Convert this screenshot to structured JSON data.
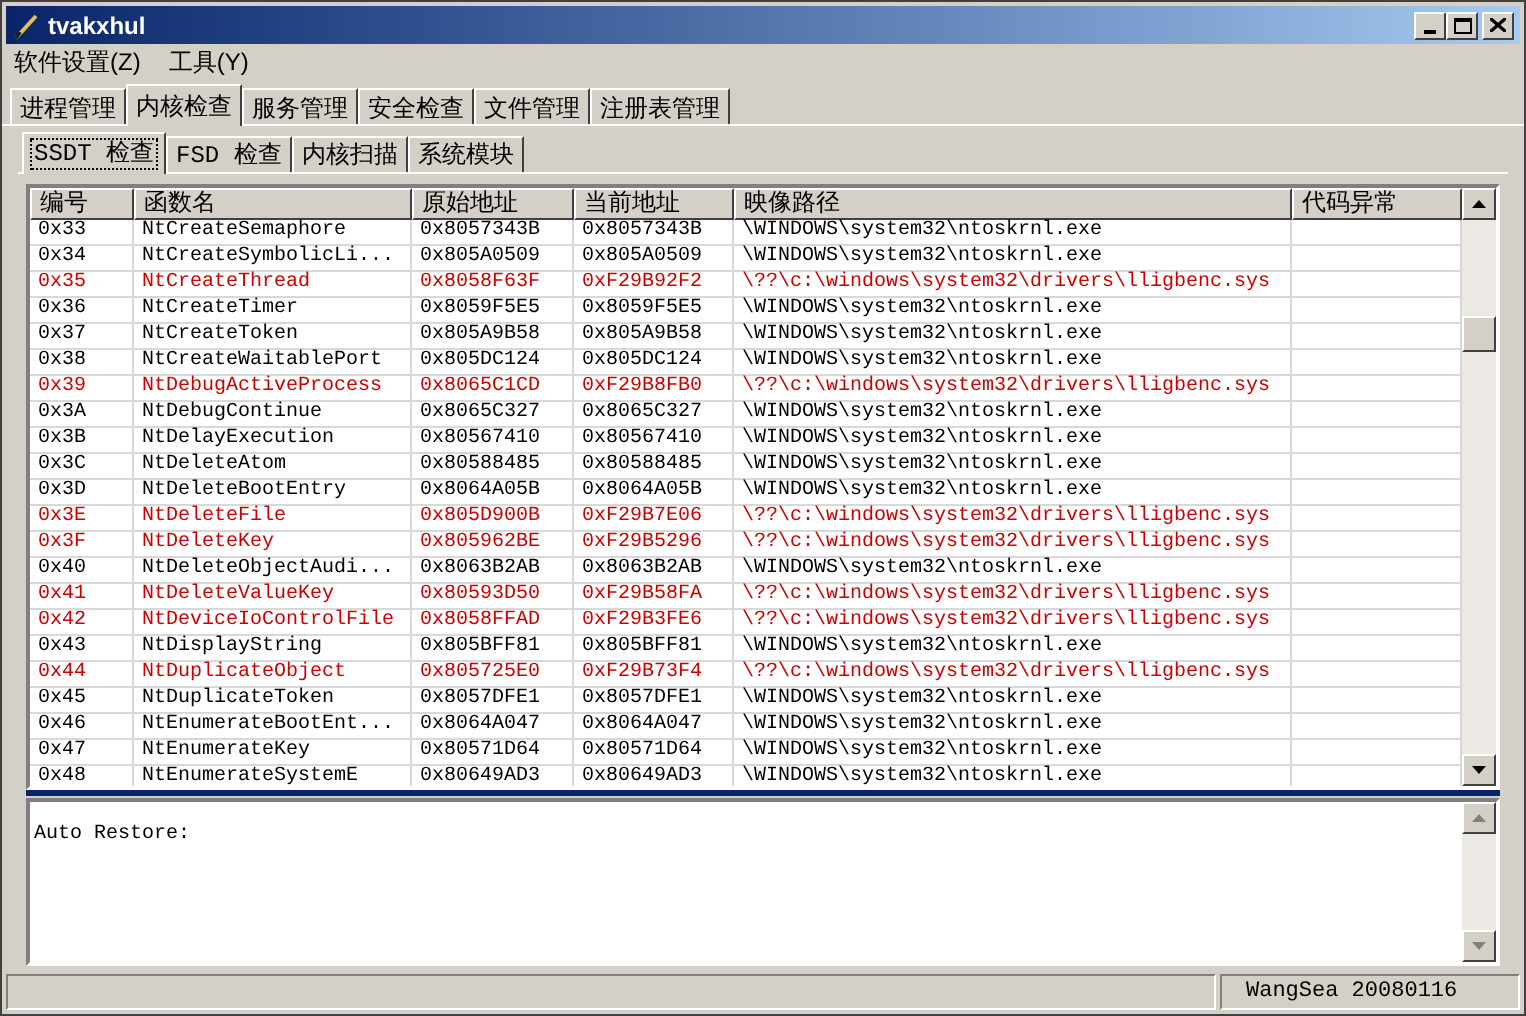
{
  "window": {
    "title": "tvakxhul"
  },
  "menu": [
    "软件设置(Z)",
    "工具(Y)"
  ],
  "tabs": [
    {
      "label": "进程管理",
      "selected": false
    },
    {
      "label": "内核检查",
      "selected": true
    },
    {
      "label": "服务管理",
      "selected": false
    },
    {
      "label": "安全检查",
      "selected": false
    },
    {
      "label": "文件管理",
      "selected": false
    },
    {
      "label": "注册表管理",
      "selected": false
    }
  ],
  "subtabs": [
    {
      "label": "SSDT 检查",
      "selected": true
    },
    {
      "label": "FSD 检查",
      "selected": false
    },
    {
      "label": "内核扫描",
      "selected": false
    },
    {
      "label": "系统模块",
      "selected": false
    }
  ],
  "table": {
    "columns": [
      "编号",
      "函数名",
      "原始地址",
      "当前地址",
      "映像路径",
      "代码异常"
    ],
    "rows": [
      {
        "cells": [
          "0x33",
          "NtCreateSemaphore",
          "0x8057343B",
          "0x8057343B",
          "\\WINDOWS\\system32\\ntoskrnl.exe"
        ],
        "hooked": false
      },
      {
        "cells": [
          "0x34",
          "NtCreateSymbolicLi...",
          "0x805A0509",
          "0x805A0509",
          "\\WINDOWS\\system32\\ntoskrnl.exe"
        ],
        "hooked": false
      },
      {
        "cells": [
          "0x35",
          "NtCreateThread",
          "0x8058F63F",
          "0xF29B92F2",
          "\\??\\c:\\windows\\system32\\drivers\\lligbenc.sys"
        ],
        "hooked": true
      },
      {
        "cells": [
          "0x36",
          "NtCreateTimer",
          "0x8059F5E5",
          "0x8059F5E5",
          "\\WINDOWS\\system32\\ntoskrnl.exe"
        ],
        "hooked": false
      },
      {
        "cells": [
          "0x37",
          "NtCreateToken",
          "0x805A9B58",
          "0x805A9B58",
          "\\WINDOWS\\system32\\ntoskrnl.exe"
        ],
        "hooked": false
      },
      {
        "cells": [
          "0x38",
          "NtCreateWaitablePort",
          "0x805DC124",
          "0x805DC124",
          "\\WINDOWS\\system32\\ntoskrnl.exe"
        ],
        "hooked": false
      },
      {
        "cells": [
          "0x39",
          "NtDebugActiveProcess",
          "0x8065C1CD",
          "0xF29B8FB0",
          "\\??\\c:\\windows\\system32\\drivers\\lligbenc.sys"
        ],
        "hooked": true
      },
      {
        "cells": [
          "0x3A",
          "NtDebugContinue",
          "0x8065C327",
          "0x8065C327",
          "\\WINDOWS\\system32\\ntoskrnl.exe"
        ],
        "hooked": false
      },
      {
        "cells": [
          "0x3B",
          "NtDelayExecution",
          "0x80567410",
          "0x80567410",
          "\\WINDOWS\\system32\\ntoskrnl.exe"
        ],
        "hooked": false
      },
      {
        "cells": [
          "0x3C",
          "NtDeleteAtom",
          "0x80588485",
          "0x80588485",
          "\\WINDOWS\\system32\\ntoskrnl.exe"
        ],
        "hooked": false
      },
      {
        "cells": [
          "0x3D",
          "NtDeleteBootEntry",
          "0x8064A05B",
          "0x8064A05B",
          "\\WINDOWS\\system32\\ntoskrnl.exe"
        ],
        "hooked": false
      },
      {
        "cells": [
          "0x3E",
          "NtDeleteFile",
          "0x805D900B",
          "0xF29B7E06",
          "\\??\\c:\\windows\\system32\\drivers\\lligbenc.sys"
        ],
        "hooked": true
      },
      {
        "cells": [
          "0x3F",
          "NtDeleteKey",
          "0x805962BE",
          "0xF29B5296",
          "\\??\\c:\\windows\\system32\\drivers\\lligbenc.sys"
        ],
        "hooked": true
      },
      {
        "cells": [
          "0x40",
          "NtDeleteObjectAudi...",
          "0x8063B2AB",
          "0x8063B2AB",
          "\\WINDOWS\\system32\\ntoskrnl.exe"
        ],
        "hooked": false
      },
      {
        "cells": [
          "0x41",
          "NtDeleteValueKey",
          "0x80593D50",
          "0xF29B58FA",
          "\\??\\c:\\windows\\system32\\drivers\\lligbenc.sys"
        ],
        "hooked": true
      },
      {
        "cells": [
          "0x42",
          "NtDeviceIoControlFile",
          "0x8058FFAD",
          "0xF29B3FE6",
          "\\??\\c:\\windows\\system32\\drivers\\lligbenc.sys"
        ],
        "hooked": true
      },
      {
        "cells": [
          "0x43",
          "NtDisplayString",
          "0x805BFF81",
          "0x805BFF81",
          "\\WINDOWS\\system32\\ntoskrnl.exe"
        ],
        "hooked": false
      },
      {
        "cells": [
          "0x44",
          "NtDuplicateObject",
          "0x805725E0",
          "0xF29B73F4",
          "\\??\\c:\\windows\\system32\\drivers\\lligbenc.sys"
        ],
        "hooked": true
      },
      {
        "cells": [
          "0x45",
          "NtDuplicateToken",
          "0x8057DFE1",
          "0x8057DFE1",
          "\\WINDOWS\\system32\\ntoskrnl.exe"
        ],
        "hooked": false
      },
      {
        "cells": [
          "0x46",
          "NtEnumerateBootEnt...",
          "0x8064A047",
          "0x8064A047",
          "\\WINDOWS\\system32\\ntoskrnl.exe"
        ],
        "hooked": false
      },
      {
        "cells": [
          "0x47",
          "NtEnumerateKey",
          "0x80571D64",
          "0x80571D64",
          "\\WINDOWS\\system32\\ntoskrnl.exe"
        ],
        "hooked": false
      },
      {
        "cells": [
          "0x48",
          "NtEnumerateSystemE",
          "0x80649AD3",
          "0x80649AD3",
          "\\WINDOWS\\system32\\ntoskrnl.exe"
        ],
        "hooked": false
      }
    ]
  },
  "log": {
    "text": "Auto Restore:"
  },
  "status_bar": [
    "WangSea 20080116"
  ]
}
